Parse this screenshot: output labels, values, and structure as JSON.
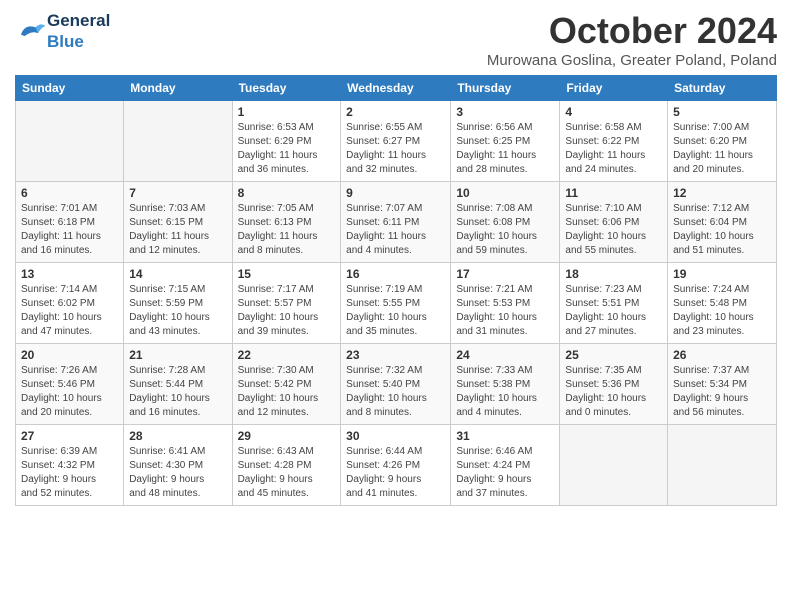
{
  "logo": {
    "general": "General",
    "blue": "Blue"
  },
  "title": "October 2024",
  "location": "Murowana Goslina, Greater Poland, Poland",
  "days_of_week": [
    "Sunday",
    "Monday",
    "Tuesday",
    "Wednesday",
    "Thursday",
    "Friday",
    "Saturday"
  ],
  "weeks": [
    [
      {
        "num": "",
        "info": ""
      },
      {
        "num": "",
        "info": ""
      },
      {
        "num": "1",
        "info": "Sunrise: 6:53 AM\nSunset: 6:29 PM\nDaylight: 11 hours\nand 36 minutes."
      },
      {
        "num": "2",
        "info": "Sunrise: 6:55 AM\nSunset: 6:27 PM\nDaylight: 11 hours\nand 32 minutes."
      },
      {
        "num": "3",
        "info": "Sunrise: 6:56 AM\nSunset: 6:25 PM\nDaylight: 11 hours\nand 28 minutes."
      },
      {
        "num": "4",
        "info": "Sunrise: 6:58 AM\nSunset: 6:22 PM\nDaylight: 11 hours\nand 24 minutes."
      },
      {
        "num": "5",
        "info": "Sunrise: 7:00 AM\nSunset: 6:20 PM\nDaylight: 11 hours\nand 20 minutes."
      }
    ],
    [
      {
        "num": "6",
        "info": "Sunrise: 7:01 AM\nSunset: 6:18 PM\nDaylight: 11 hours\nand 16 minutes."
      },
      {
        "num": "7",
        "info": "Sunrise: 7:03 AM\nSunset: 6:15 PM\nDaylight: 11 hours\nand 12 minutes."
      },
      {
        "num": "8",
        "info": "Sunrise: 7:05 AM\nSunset: 6:13 PM\nDaylight: 11 hours\nand 8 minutes."
      },
      {
        "num": "9",
        "info": "Sunrise: 7:07 AM\nSunset: 6:11 PM\nDaylight: 11 hours\nand 4 minutes."
      },
      {
        "num": "10",
        "info": "Sunrise: 7:08 AM\nSunset: 6:08 PM\nDaylight: 10 hours\nand 59 minutes."
      },
      {
        "num": "11",
        "info": "Sunrise: 7:10 AM\nSunset: 6:06 PM\nDaylight: 10 hours\nand 55 minutes."
      },
      {
        "num": "12",
        "info": "Sunrise: 7:12 AM\nSunset: 6:04 PM\nDaylight: 10 hours\nand 51 minutes."
      }
    ],
    [
      {
        "num": "13",
        "info": "Sunrise: 7:14 AM\nSunset: 6:02 PM\nDaylight: 10 hours\nand 47 minutes."
      },
      {
        "num": "14",
        "info": "Sunrise: 7:15 AM\nSunset: 5:59 PM\nDaylight: 10 hours\nand 43 minutes."
      },
      {
        "num": "15",
        "info": "Sunrise: 7:17 AM\nSunset: 5:57 PM\nDaylight: 10 hours\nand 39 minutes."
      },
      {
        "num": "16",
        "info": "Sunrise: 7:19 AM\nSunset: 5:55 PM\nDaylight: 10 hours\nand 35 minutes."
      },
      {
        "num": "17",
        "info": "Sunrise: 7:21 AM\nSunset: 5:53 PM\nDaylight: 10 hours\nand 31 minutes."
      },
      {
        "num": "18",
        "info": "Sunrise: 7:23 AM\nSunset: 5:51 PM\nDaylight: 10 hours\nand 27 minutes."
      },
      {
        "num": "19",
        "info": "Sunrise: 7:24 AM\nSunset: 5:48 PM\nDaylight: 10 hours\nand 23 minutes."
      }
    ],
    [
      {
        "num": "20",
        "info": "Sunrise: 7:26 AM\nSunset: 5:46 PM\nDaylight: 10 hours\nand 20 minutes."
      },
      {
        "num": "21",
        "info": "Sunrise: 7:28 AM\nSunset: 5:44 PM\nDaylight: 10 hours\nand 16 minutes."
      },
      {
        "num": "22",
        "info": "Sunrise: 7:30 AM\nSunset: 5:42 PM\nDaylight: 10 hours\nand 12 minutes."
      },
      {
        "num": "23",
        "info": "Sunrise: 7:32 AM\nSunset: 5:40 PM\nDaylight: 10 hours\nand 8 minutes."
      },
      {
        "num": "24",
        "info": "Sunrise: 7:33 AM\nSunset: 5:38 PM\nDaylight: 10 hours\nand 4 minutes."
      },
      {
        "num": "25",
        "info": "Sunrise: 7:35 AM\nSunset: 5:36 PM\nDaylight: 10 hours\nand 0 minutes."
      },
      {
        "num": "26",
        "info": "Sunrise: 7:37 AM\nSunset: 5:34 PM\nDaylight: 9 hours\nand 56 minutes."
      }
    ],
    [
      {
        "num": "27",
        "info": "Sunrise: 6:39 AM\nSunset: 4:32 PM\nDaylight: 9 hours\nand 52 minutes."
      },
      {
        "num": "28",
        "info": "Sunrise: 6:41 AM\nSunset: 4:30 PM\nDaylight: 9 hours\nand 48 minutes."
      },
      {
        "num": "29",
        "info": "Sunrise: 6:43 AM\nSunset: 4:28 PM\nDaylight: 9 hours\nand 45 minutes."
      },
      {
        "num": "30",
        "info": "Sunrise: 6:44 AM\nSunset: 4:26 PM\nDaylight: 9 hours\nand 41 minutes."
      },
      {
        "num": "31",
        "info": "Sunrise: 6:46 AM\nSunset: 4:24 PM\nDaylight: 9 hours\nand 37 minutes."
      },
      {
        "num": "",
        "info": ""
      },
      {
        "num": "",
        "info": ""
      }
    ]
  ]
}
